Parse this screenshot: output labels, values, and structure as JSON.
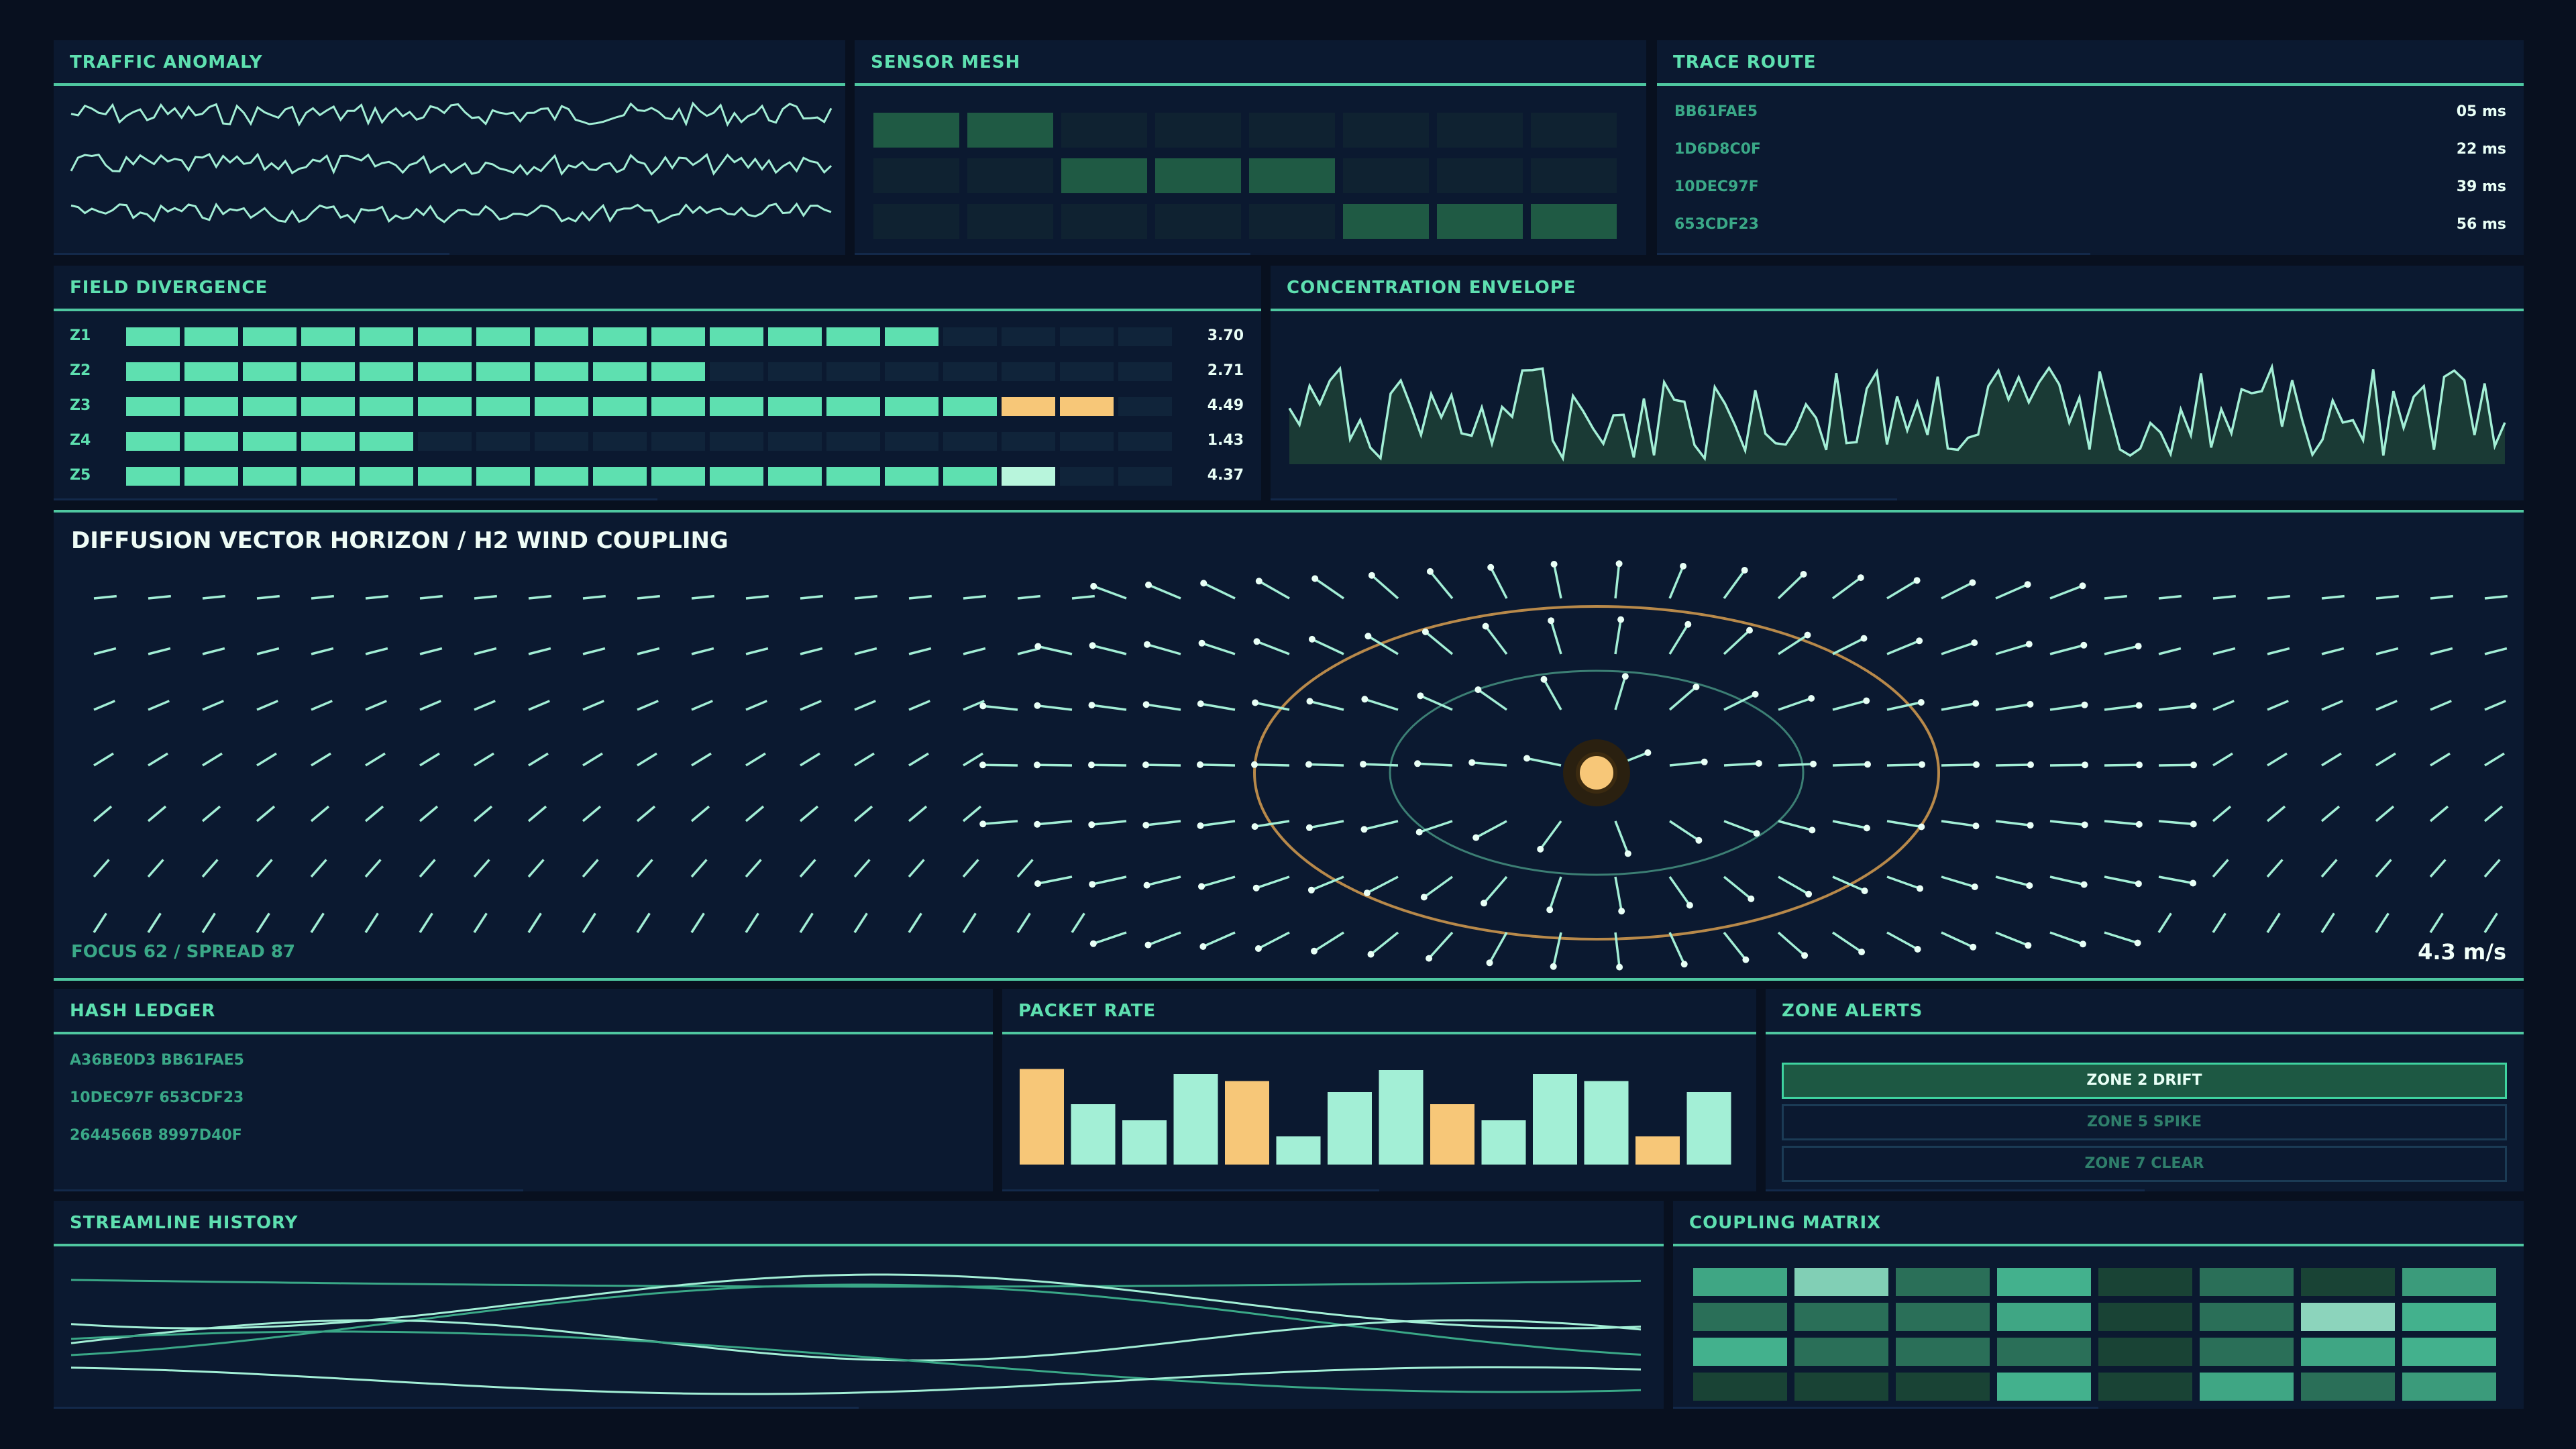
{
  "colors": {
    "background": "#08101f",
    "panel": "#0b1930",
    "accent": "#5ee0b0",
    "light": "#a3efd6",
    "warn": "#f7c778",
    "line": "#4fc7a0"
  },
  "traffic": {
    "title": "TRAFFIC ANOMALY"
  },
  "sensor": {
    "title": "SENSOR MESH",
    "cells": [
      [
        1,
        1,
        0,
        0,
        0,
        0,
        0,
        0
      ],
      [
        0,
        0,
        1,
        1,
        1,
        0,
        0,
        0
      ],
      [
        0,
        0,
        0,
        0,
        0,
        1,
        1,
        1
      ]
    ]
  },
  "trace": {
    "title": "TRACE ROUTE",
    "rows": [
      {
        "id": "BB61FAE5",
        "ms": "05 ms"
      },
      {
        "id": "1D6D8C0F",
        "ms": "22 ms"
      },
      {
        "id": "10DEC97F",
        "ms": "39 ms"
      },
      {
        "id": "653CDF23",
        "ms": "56 ms"
      }
    ]
  },
  "field": {
    "title": "FIELD DIVERGENCE",
    "rows": [
      {
        "label": "Z1",
        "value": "3.70",
        "filled": 14,
        "warn": 0,
        "light": 0
      },
      {
        "label": "Z2",
        "value": "2.71",
        "filled": 10,
        "warn": 0,
        "light": 0
      },
      {
        "label": "Z3",
        "value": "4.49",
        "filled": 15,
        "warn": 2,
        "light": 0
      },
      {
        "label": "Z4",
        "value": "1.43",
        "filled": 5,
        "warn": 0,
        "light": 0
      },
      {
        "label": "Z5",
        "value": "4.37",
        "filled": 15,
        "warn": 0,
        "light": 1
      }
    ]
  },
  "envelope": {
    "title": "CONCENTRATION ENVELOPE"
  },
  "diffusion": {
    "title": "DIFFUSION VECTOR HORIZON / H2 WIND COUPLING",
    "focus_label": "FOCUS 62 / SPREAD 87",
    "speed": "4.3 m/s"
  },
  "hash": {
    "title": "HASH LEDGER",
    "lines": [
      "A36BE0D3 BB61FAE5",
      "10DEC97F 653CDF23",
      "2644566B 8997D40F"
    ]
  },
  "packet": {
    "title": "PACKET RATE",
    "bars": [
      {
        "v": 0.95,
        "c": "warn"
      },
      {
        "v": 0.6,
        "c": "light"
      },
      {
        "v": 0.44,
        "c": "light"
      },
      {
        "v": 0.9,
        "c": "light"
      },
      {
        "v": 0.83,
        "c": "warn"
      },
      {
        "v": 0.28,
        "c": "light"
      },
      {
        "v": 0.72,
        "c": "light"
      },
      {
        "v": 0.94,
        "c": "light"
      },
      {
        "v": 0.6,
        "c": "warn"
      },
      {
        "v": 0.44,
        "c": "light"
      },
      {
        "v": 0.9,
        "c": "light"
      },
      {
        "v": 0.83,
        "c": "light"
      },
      {
        "v": 0.28,
        "c": "warn"
      },
      {
        "v": 0.72,
        "c": "light"
      }
    ]
  },
  "zones": {
    "title": "ZONE ALERTS",
    "items": [
      {
        "label": "ZONE 2 DRIFT",
        "active": true
      },
      {
        "label": "ZONE 5 SPIKE",
        "active": false
      },
      {
        "label": "ZONE 7 CLEAR",
        "active": false
      }
    ]
  },
  "streamline": {
    "title": "STREAMLINE HISTORY"
  },
  "coupling": {
    "title": "COUPLING MATRIX",
    "cells": [
      [
        0.55,
        0.9,
        0.3,
        0.6,
        0.1,
        0.3,
        0.1,
        0.5
      ],
      [
        0.3,
        0.3,
        0.3,
        0.55,
        0.1,
        0.3,
        0.95,
        0.6
      ],
      [
        0.6,
        0.3,
        0.3,
        0.3,
        0.1,
        0.3,
        0.55,
        0.6
      ],
      [
        0.1,
        0.1,
        0.1,
        0.6,
        0.1,
        0.55,
        0.3,
        0.5
      ]
    ]
  }
}
